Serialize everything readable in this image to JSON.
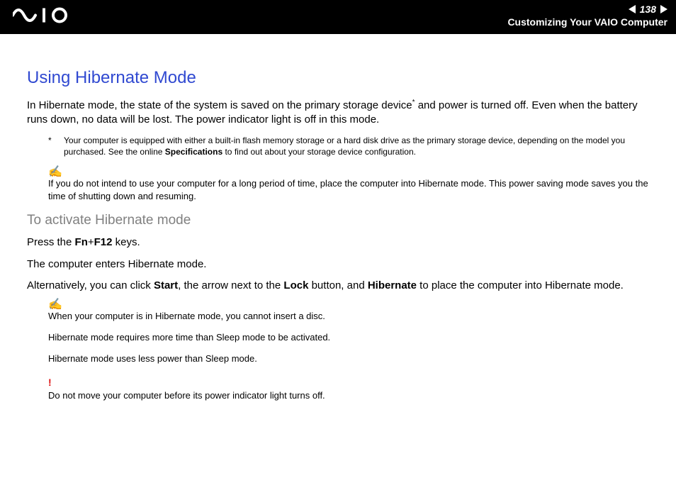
{
  "header": {
    "page_number": "138",
    "breadcrumb": "Customizing Your VAIO Computer"
  },
  "title": "Using Hibernate Mode",
  "intro": {
    "pre_sup": "In Hibernate mode, the state of the system is saved on the primary storage device",
    "sup": "*",
    "post_sup": " and power is turned off. Even when the battery runs down, no data will be lost. The power indicator light is off in this mode."
  },
  "footnote": {
    "marker": "*",
    "text_pre": "Your computer is equipped with either a built-in flash memory storage or a hard disk drive as the primary storage device, depending on the model you purchased. See the online ",
    "bold": "Specifications",
    "text_post": " to find out about your storage device configuration."
  },
  "tip1": "If you do not intend to use your computer for a long period of time, place the computer into Hibernate mode. This power saving mode saves you the time of shutting down and resuming.",
  "subhead": "To activate Hibernate mode",
  "press_line": {
    "pre": "Press the ",
    "k1": "Fn",
    "plus": "+",
    "k2": "F12",
    "post": " keys."
  },
  "enters_line": "The computer enters Hibernate mode.",
  "alt_line": {
    "p1": "Alternatively, you can click ",
    "b1": "Start",
    "p2": ", the arrow next to the ",
    "b2": "Lock",
    "p3": " button, and ",
    "b3": "Hibernate",
    "p4": " to place the computer into Hibernate mode."
  },
  "tip2_a": "When your computer is in Hibernate mode, you cannot insert a disc.",
  "tip2_b": "Hibernate mode requires more time than Sleep mode to be activated.",
  "tip2_c": "Hibernate mode uses less power than Sleep mode.",
  "warn": "Do not move your computer before its power indicator light turns off."
}
